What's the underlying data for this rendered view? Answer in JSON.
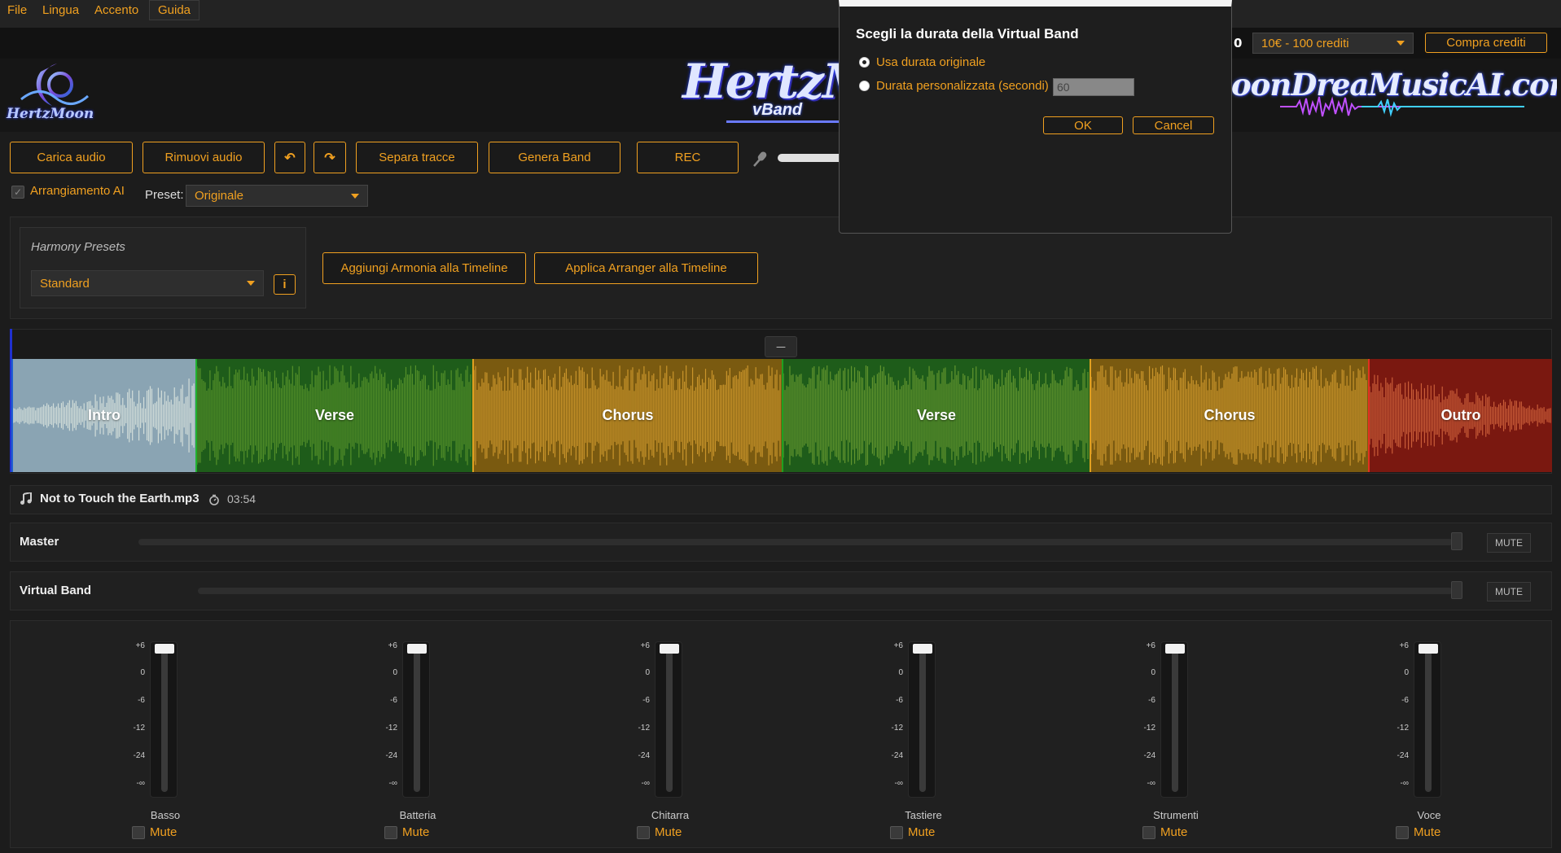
{
  "menu": {
    "file": "File",
    "lingua": "Lingua",
    "accento": "Accento",
    "guida": "Guida"
  },
  "credits": {
    "value": "0",
    "package": "10€ - 100 crediti",
    "buy_label": "Compra crediti"
  },
  "branding": {
    "small_logo_text": "HertzMoon",
    "center_logo_text": "HertzMo",
    "center_logo_sub": "vBand",
    "right_logo_text": "oonDreaMusicAI.com"
  },
  "toolbar": {
    "carica": "Carica audio",
    "rimuovi": "Rimuovi audio",
    "undo": "↶",
    "redo": "↷",
    "separa": "Separa tracce",
    "genera": "Genera Band",
    "rec": "REC"
  },
  "arrangement": {
    "ai_label": "Arrangiamento AI",
    "preset_label": "Preset:",
    "preset_value": "Originale"
  },
  "harmony": {
    "title": "Harmony Presets",
    "preset_value": "Standard",
    "info": "i",
    "add_harmony": "Aggiungi Armonia alla Timeline",
    "apply_arranger": "Applica Arranger alla Timeline"
  },
  "timeline": {
    "collapse": "—",
    "segments": [
      {
        "label": "Intro",
        "color": "#8aa4b3",
        "wave": "#dfe8e0"
      },
      {
        "label": "Verse",
        "color": "#1e5c1a",
        "wave": "#5e9a2c"
      },
      {
        "label": "Chorus",
        "color": "#7a5a10",
        "wave": "#d9a030"
      },
      {
        "label": "Verse",
        "color": "#1e5c1a",
        "wave": "#6ea032"
      },
      {
        "label": "Chorus",
        "color": "#7a5a10",
        "wave": "#d9a030"
      },
      {
        "label": "Outro",
        "color": "#7a1810",
        "wave": "#d86a40"
      }
    ]
  },
  "file_info": {
    "filename": "Not to Touch the Earth.mp3",
    "duration": "03:54"
  },
  "mixer": {
    "master_label": "Master",
    "virtual_band_label": "Virtual Band",
    "mute_label": "MUTE",
    "scale": [
      "+6",
      "0",
      "-6",
      "-12",
      "-24",
      "-∞"
    ],
    "channel_mute_label": "Mute",
    "channels": [
      "Basso",
      "Batteria",
      "Chitarra",
      "Tastiere",
      "Strumenti",
      "Voce"
    ]
  },
  "dialog": {
    "title": "Scegli la durata della Virtual Band",
    "option_original": "Usa durata originale",
    "option_custom": "Durata personalizzata (secondi)",
    "custom_value": "60",
    "ok": "OK",
    "cancel": "Cancel"
  },
  "colors": {
    "accent": "#f0a020",
    "background": "#1c1c1c"
  }
}
